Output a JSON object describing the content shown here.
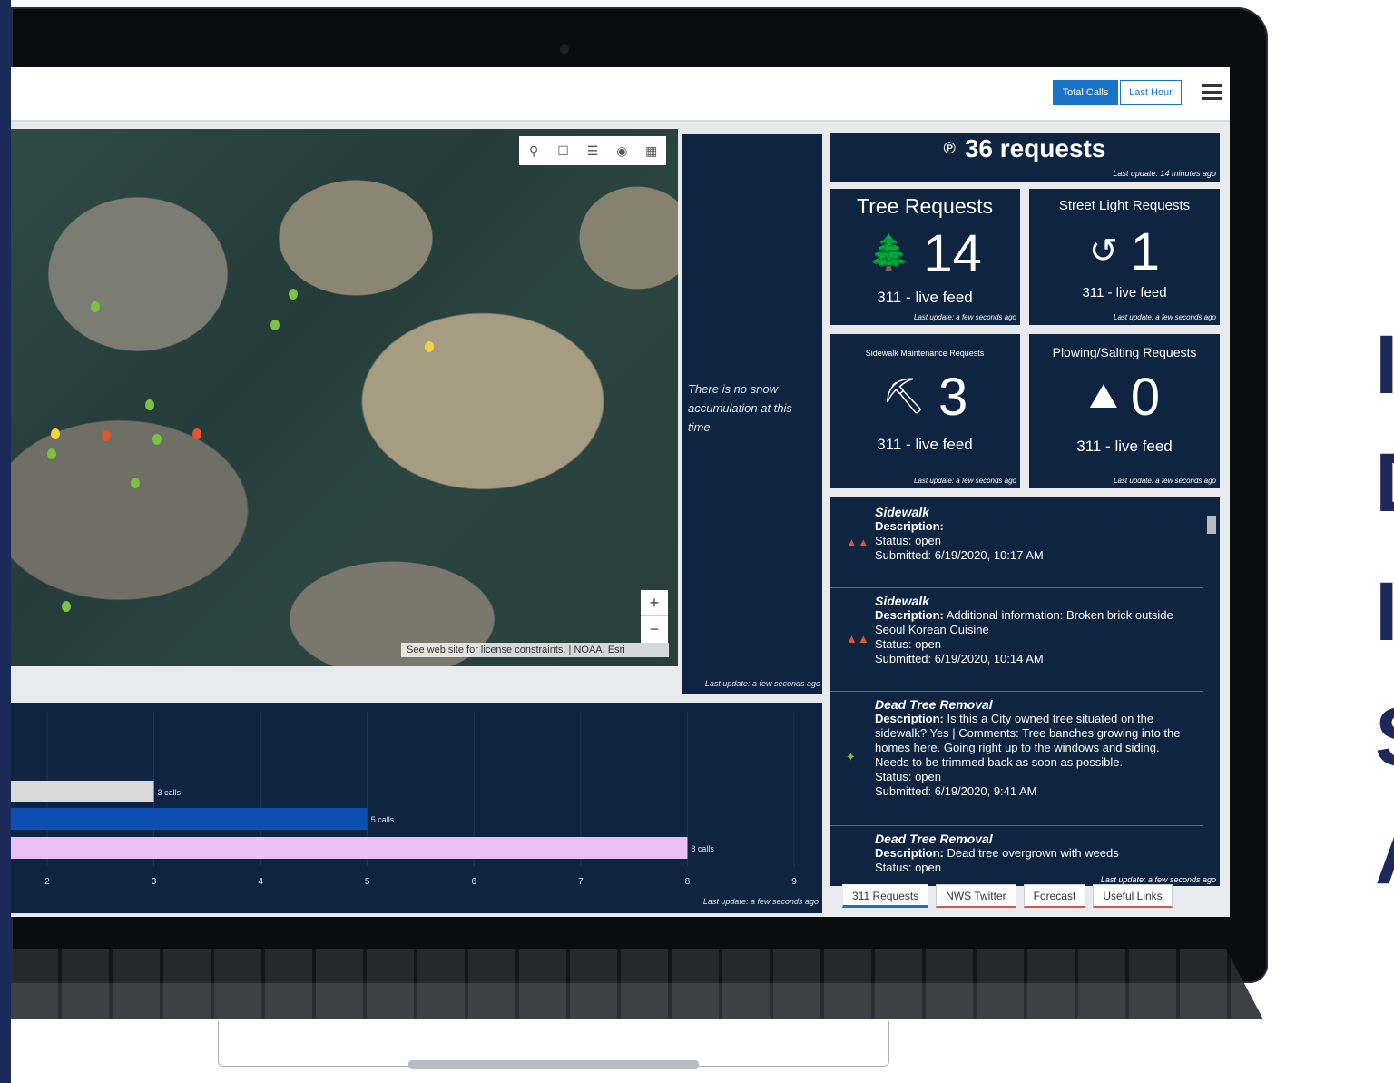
{
  "header": {
    "toggle_total": "Total Calls",
    "toggle_last_hour": "Last Hour"
  },
  "map": {
    "attribution": "See web site for license constraints. | NOAA, Esri",
    "zoom_in": "+",
    "zoom_out": "−",
    "tools": [
      "search-icon",
      "bookmark-icon",
      "legend-icon",
      "layers-icon",
      "qr-icon"
    ]
  },
  "snow": {
    "message": "There is no snow accumulation at this time",
    "update": "Last update: a few seconds ago"
  },
  "summary": {
    "value": "36 requests",
    "update": "Last update: 14 minutes ago"
  },
  "metrics": {
    "tree": {
      "title": "Tree Requests",
      "value": "14",
      "feed": "311 - live feed",
      "update": "Last update: a few seconds ago"
    },
    "light": {
      "title": "Street Light Requests",
      "value": "1",
      "feed": "311 - live feed",
      "update": "Last update: a few seconds ago"
    },
    "sidewalk": {
      "title": "Sidewalk Maintenance Requests",
      "value": "3",
      "feed": "311 - live feed",
      "update": "Last update: a few seconds ago"
    },
    "plowing": {
      "title": "Plowing/Salting Requests",
      "value": "0",
      "feed": "311 - live feed",
      "update": "Last update: a few seconds ago"
    }
  },
  "list": {
    "update": "Last update: a few seconds ago",
    "items": [
      {
        "name": "Sidewalk",
        "desc_label": "Description:",
        "desc": "",
        "status": "Status: open",
        "submitted": "Submitted: 6/19/2020, 10:17 AM"
      },
      {
        "name": "Sidewalk",
        "desc_label": "Description:",
        "desc": " Additional information: Broken brick outside Seoul Korean Cuisine",
        "status": "Status: open",
        "submitted": "Submitted: 6/19/2020, 10:14 AM"
      },
      {
        "name": "Dead Tree Removal",
        "desc_label": "Description:",
        "desc": " Is this a City owned tree situated on the sidewalk? Yes | Comments: Tree banches growing into the homes here. Going right up to the windows and siding. Needs to be trimmed back as soon as possible.",
        "status": "Status: open",
        "submitted": "Submitted: 6/19/2020, 9:41 AM"
      },
      {
        "name": "Dead Tree Removal",
        "desc_label": "Description:",
        "desc": " Dead tree overgrown with weeds",
        "status": "Status: open",
        "submitted": ""
      }
    ]
  },
  "tabs": [
    "311 Requests",
    "NWS Twitter",
    "Forecast",
    "Useful Links"
  ],
  "chart_data": {
    "type": "bar",
    "orientation": "horizontal",
    "categories": [
      "",
      "",
      ""
    ],
    "values": [
      3,
      5,
      8
    ],
    "value_labels": [
      "3 calls",
      "5 calls",
      "8 calls"
    ],
    "bar_colors": [
      "#d9d9d9",
      "#0b4fb3",
      "#e8c2f7"
    ],
    "x_ticks": [
      "2",
      "3",
      "4",
      "5",
      "6",
      "7",
      "8",
      "9"
    ],
    "xlim_visible": [
      1,
      9
    ],
    "update": "Last update: a few seconds ago"
  },
  "headline_letters": [
    "I",
    "D",
    "I",
    "S",
    "A"
  ]
}
